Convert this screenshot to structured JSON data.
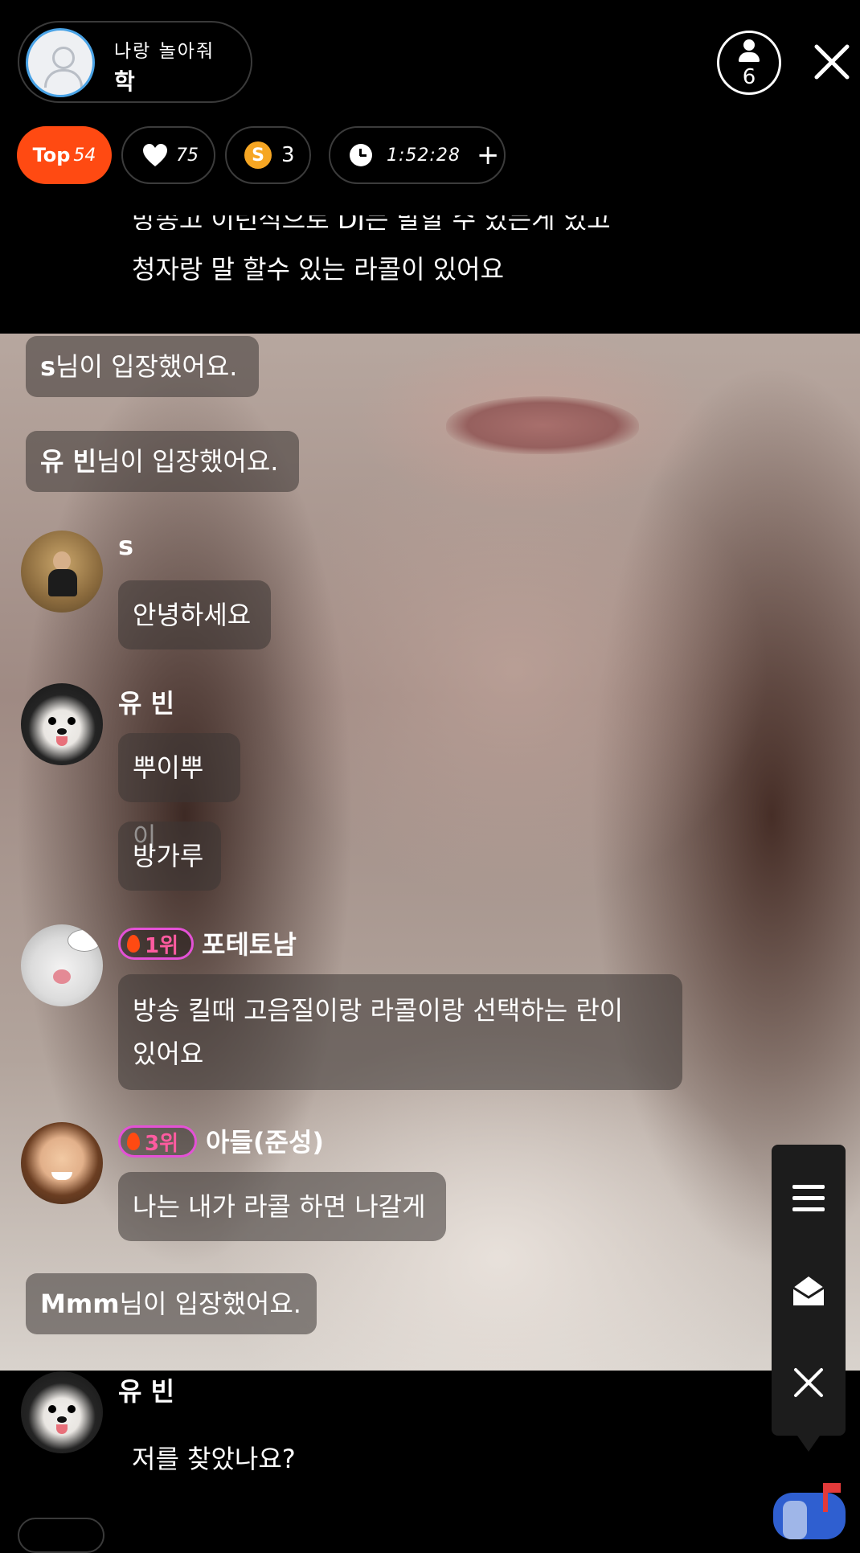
{
  "header": {
    "room_title": "나랑 놀아줘",
    "host_name": "학",
    "viewer_count": "6"
  },
  "chips": {
    "top_label": "Top",
    "top_rank": "54",
    "likes": "75",
    "coin_symbol": "S",
    "coins": "3",
    "elapsed_time": "1:52:28",
    "add_time_label": "+"
  },
  "notice": {
    "line_partial": "방송고 이런식으로 DJ는 말할 수 있는게 있고",
    "line": "청자랑 말 할수 있는 라콜이 있어요"
  },
  "chat": {
    "sys1": {
      "user": "s",
      "text": "님이 입장했어요."
    },
    "sys2": {
      "user": "유 빈",
      "text": "님이 입장했어요."
    },
    "msg_s": {
      "name": "s",
      "text": "안녕하세요"
    },
    "msg_yubin": {
      "name": "유 빈",
      "text1": "뿌이뿌이",
      "text2": "방가루"
    },
    "msg_potetonam": {
      "rank": "1위",
      "name": "포테토남",
      "text_line1": "방송 킬때 고음질이랑 라콜이랑 선택하는 란이",
      "text_line2": "있어요"
    },
    "msg_son": {
      "rank": "3위",
      "name": "아들(준성)",
      "text": "나는 내가 라콜 하면 나갈게"
    },
    "sys3": {
      "user": "Mmm",
      "text": "님이 입장했어요."
    },
    "msg_yubin2": {
      "name": "유 빈",
      "text": "저를 찾았나요?"
    }
  },
  "colors": {
    "accent": "#ff4a12",
    "rank_badge": "#e451d6",
    "coin": "#f6a623"
  }
}
